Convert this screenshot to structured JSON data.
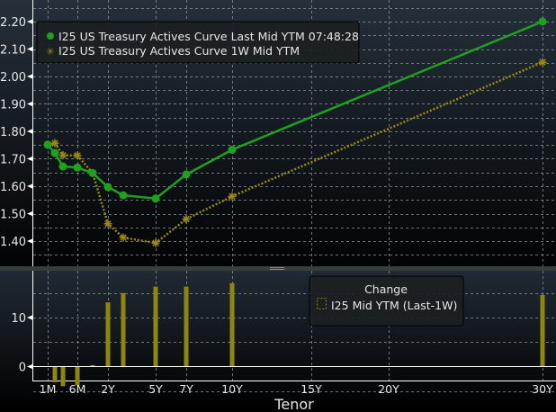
{
  "chart_data": [
    {
      "type": "line",
      "title": "",
      "xlabel": "Tenor",
      "ylabel": "",
      "ylim": [
        1.33,
        2.27
      ],
      "yticks": [
        "1.40",
        "1.50",
        "1.60",
        "1.70",
        "1.80",
        "1.90",
        "2.00",
        "2.10",
        "2.20"
      ],
      "grid": true,
      "legend_position": "top-left",
      "x_tenors": [
        "1M",
        "2M",
        "3M",
        "6M",
        "1Y",
        "2Y",
        "3Y",
        "5Y",
        "7Y",
        "10Y",
        "30Y"
      ],
      "x": [
        0.0833,
        0.1667,
        0.25,
        0.5,
        1,
        2,
        3,
        5,
        7,
        10,
        30
      ],
      "series": [
        {
          "name": "I25 US Treasury Actives Curve Last Mid YTM 07:48:28",
          "color": "#1fa01f",
          "marker": "circle",
          "values": [
            1.751,
            1.721,
            1.672,
            1.668,
            1.648,
            1.597,
            1.567,
            1.555,
            1.643,
            1.733,
            2.2
          ]
        },
        {
          "name": "I25 US Treasury Actives Curve 1W Mid YTM",
          "color": "#9a8a14",
          "marker": "star",
          "values": [
            1.752,
            1.757,
            1.713,
            1.712,
            1.648,
            1.463,
            1.413,
            1.393,
            1.48,
            1.563,
            2.052
          ]
        }
      ]
    },
    {
      "type": "bar",
      "title": "Change",
      "xlabel": "Tenor",
      "ylim": [
        -6.5,
        19
      ],
      "yticks": [
        "0",
        "10"
      ],
      "grid": true,
      "legend_position": "top-right",
      "x": [
        0.1667,
        0.25,
        0.5,
        1,
        2,
        3,
        5,
        7,
        10,
        30
      ],
      "series": [
        {
          "name": "I25 Mid YTM (Last-1W)",
          "color": "#8f860f",
          "values": [
            -3.2,
            -4.0,
            -3.8,
            0.3,
            13.1,
            15.0,
            16.3,
            16.3,
            17.0,
            14.6
          ]
        }
      ]
    }
  ],
  "xaxis": {
    "ticks": [
      {
        "label": "1M",
        "value": 0.0833
      },
      {
        "label": "6M",
        "value": 0.5
      },
      {
        "label": "2Y",
        "value": 2
      },
      {
        "label": "5Y",
        "value": 5
      },
      {
        "label": "7Y",
        "value": 7
      },
      {
        "label": "10Y",
        "value": 10
      },
      {
        "label": "15Y",
        "value": 15
      },
      {
        "label": "20Y",
        "value": 20
      },
      {
        "label": "30Y",
        "value": 30
      }
    ],
    "title": "Tenor"
  }
}
